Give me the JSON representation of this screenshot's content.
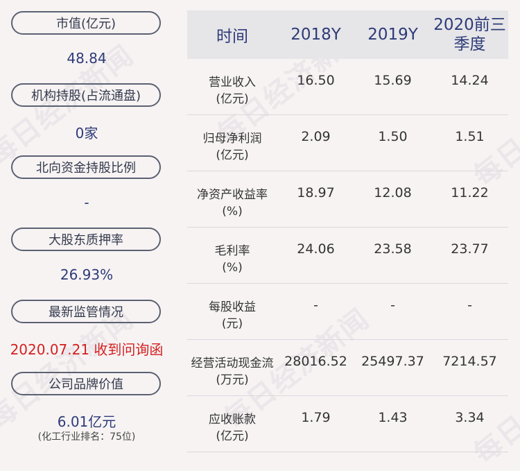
{
  "left_panel": {
    "items": [
      {
        "label": "市值(亿元)",
        "value": "48.84"
      },
      {
        "label": "机构持股(占流通盘)",
        "value": "0家"
      },
      {
        "label": "北向资金持股比例",
        "value": "-"
      },
      {
        "label": "大股东质押率",
        "value": "26.93%"
      },
      {
        "label": "最新监管情况",
        "value": "2020.07.21 收到问询函"
      },
      {
        "label": "公司品牌价值",
        "value": "6.01亿元",
        "note": "(化工行业排名：75位)"
      }
    ]
  },
  "table": {
    "headers": [
      "时间",
      "2018Y",
      "2019Y",
      "2020前三季度"
    ],
    "rows": [
      {
        "name": "营业收入",
        "unit": "(亿元)",
        "values": [
          "16.50",
          "15.69",
          "14.24"
        ]
      },
      {
        "name": "归母净利润",
        "unit": "(亿元)",
        "values": [
          "2.09",
          "1.50",
          "1.51"
        ]
      },
      {
        "name": "净资产收益率",
        "unit": "(%)",
        "values": [
          "18.97",
          "12.08",
          "11.22"
        ]
      },
      {
        "name": "毛利率",
        "unit": "(%)",
        "values": [
          "24.06",
          "23.58",
          "23.77"
        ]
      },
      {
        "name": "每股收益",
        "unit": "(元)",
        "values": [
          "-",
          "-",
          "-"
        ]
      },
      {
        "name": "经营活动现金流",
        "unit": "(万元)",
        "values": [
          "28016.52",
          "25497.37",
          "7214.57"
        ]
      },
      {
        "name": "应收账款",
        "unit": "(亿元)",
        "values": [
          "1.79",
          "1.43",
          "3.34"
        ]
      }
    ]
  },
  "watermark": "每日经济新闻",
  "colors": {
    "value_blue": "#2d3b78",
    "alert_red": "#d31f1f",
    "header_bg": "#e6e5e8",
    "pill_border": "#5b6172"
  }
}
